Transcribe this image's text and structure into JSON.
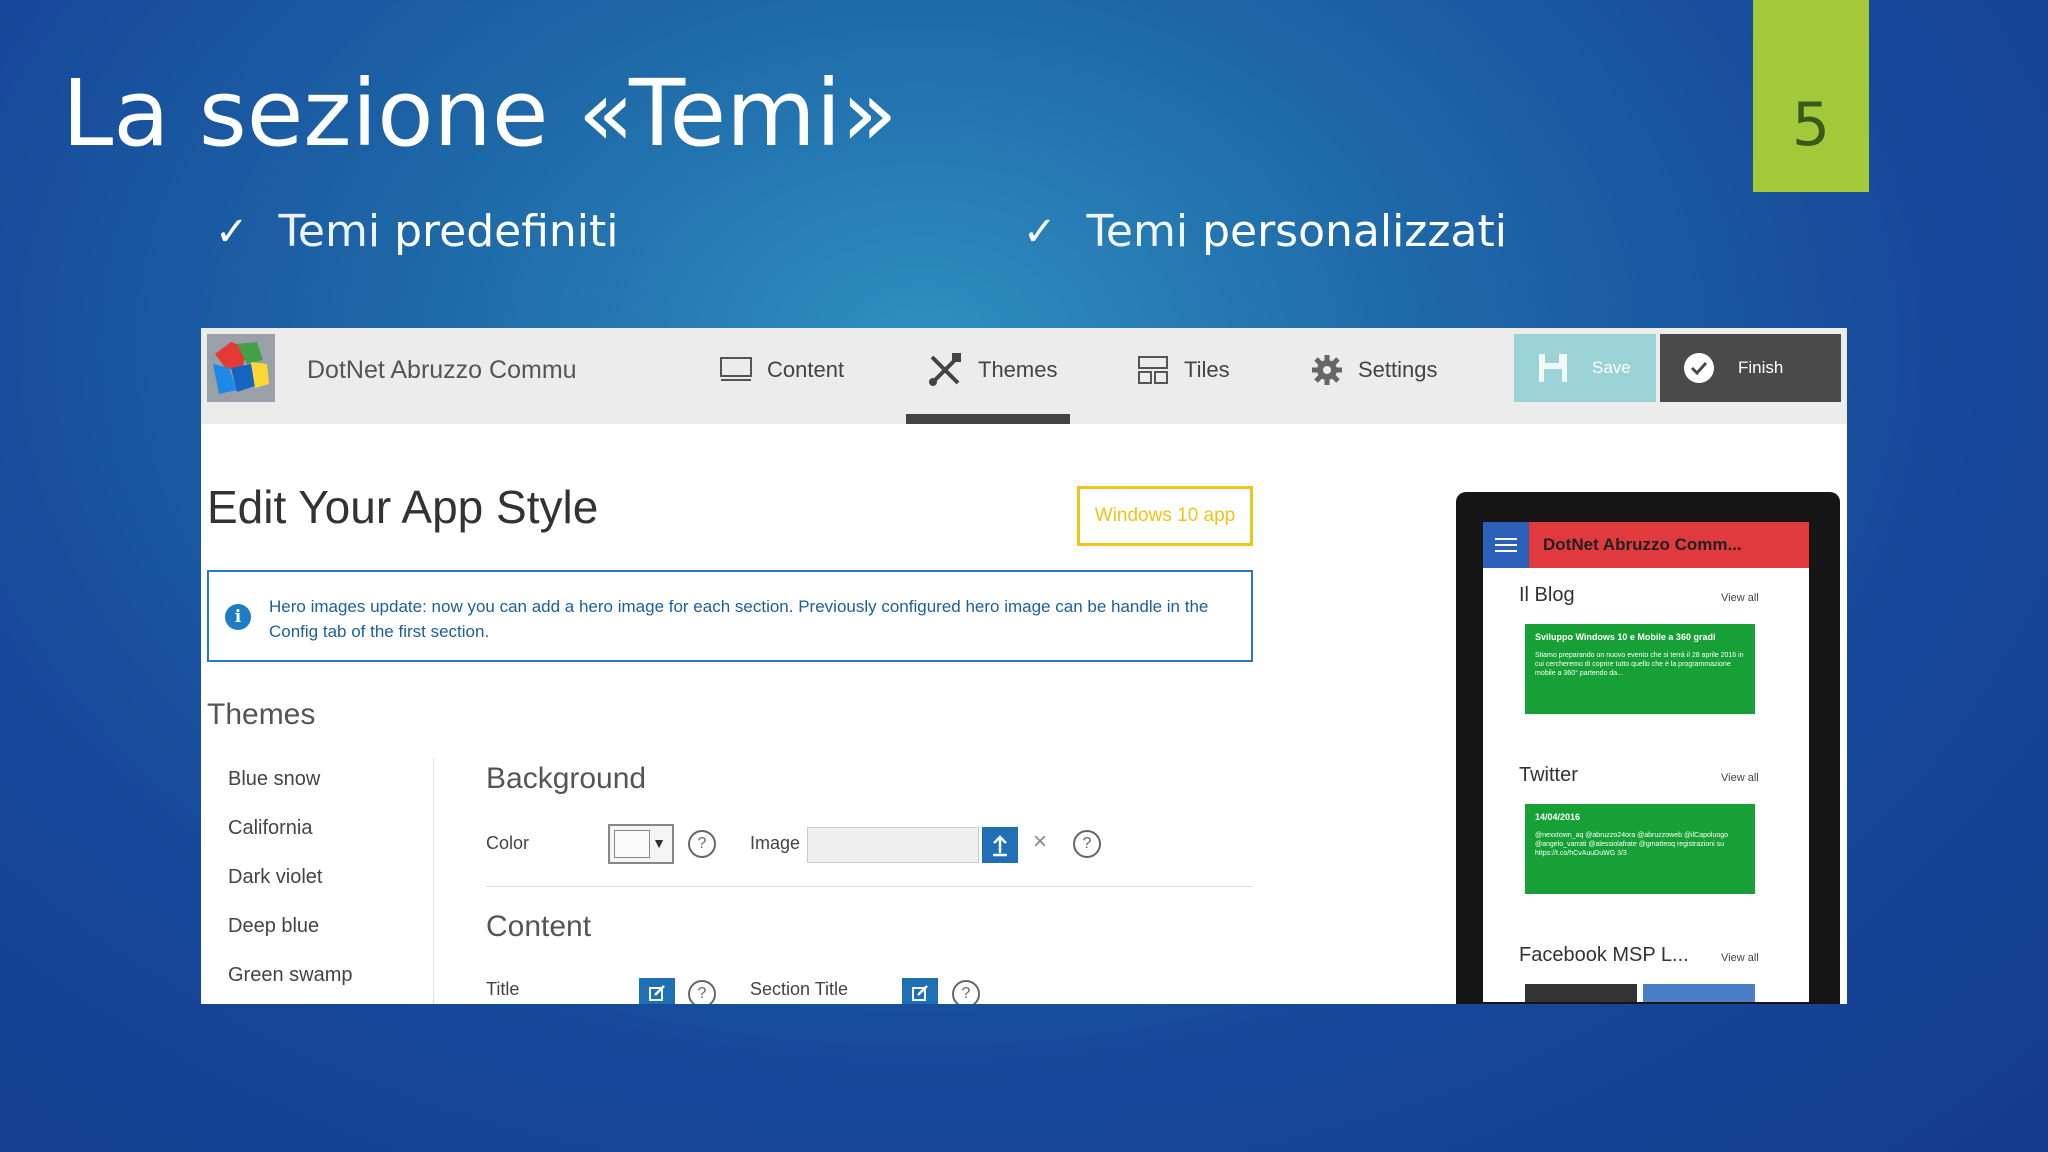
{
  "slide": {
    "title": "La sezione «Temi»",
    "page_number": "5",
    "bullets": [
      {
        "check": "✓",
        "light": "Temi",
        "strong": "predefiniti"
      },
      {
        "check": "✓",
        "light": "Temi",
        "strong": "personalizzati"
      }
    ]
  },
  "app": {
    "name": "DotNet Abruzzo Commu",
    "nav": [
      {
        "label": "Content",
        "icon": "monitor-icon"
      },
      {
        "label": "Themes",
        "icon": "tools-icon",
        "active": true
      },
      {
        "label": "Tiles",
        "icon": "tiles-icon"
      },
      {
        "label": "Settings",
        "icon": "gear-icon"
      }
    ],
    "save_label": "Save",
    "finish_label": "Finish",
    "page_heading": "Edit Your App Style",
    "badge": "Windows 10 app",
    "info_text": "Hero images update: now you can add a hero image for each section. Previously configured hero image can be handle in the Config tab of the first section.",
    "themes_heading": "Themes",
    "themes": [
      "Blue snow",
      "California",
      "Dark violet",
      "Deep blue",
      "Green swamp"
    ],
    "background_heading": "Background",
    "color_label": "Color",
    "image_label": "Image",
    "content_heading": "Content",
    "title_label": "Title",
    "section_title_label": "Section Title",
    "help_glyph": "?",
    "clear_glyph": "×",
    "dropdown_glyph": "▼"
  },
  "preview": {
    "title": "DotNet Abruzzo Comm...",
    "view_all": "View all",
    "sections": [
      {
        "name": "Il Blog",
        "card_title": "Sviluppo Windows 10 e Mobile a 360 gradi",
        "card_body": "Stiamo preparando un nuovo evento che si terrà il 28 aprile 2016 in cui cercheremo di coprire tutto quello che è la programmazione mobile a 360° partendo da..."
      },
      {
        "name": "Twitter",
        "card_title": "14/04/2016",
        "card_body": "@nexxtown_aq @abruzzo24ora @abruzzoweb @ilCapoluogo @angelo_varrati @alessiolafrate @gmatteoq registrazioni su https://t.co/hCvAuuDuWG 3/3"
      },
      {
        "name": "Facebook MSP L..."
      }
    ]
  },
  "colors": {
    "page_tab": "#a3c93a",
    "accent_blue": "#1f6fb5",
    "badge_yellow": "#f0c419",
    "preview_header": "#e03a3e",
    "preview_card": "#16a035"
  }
}
